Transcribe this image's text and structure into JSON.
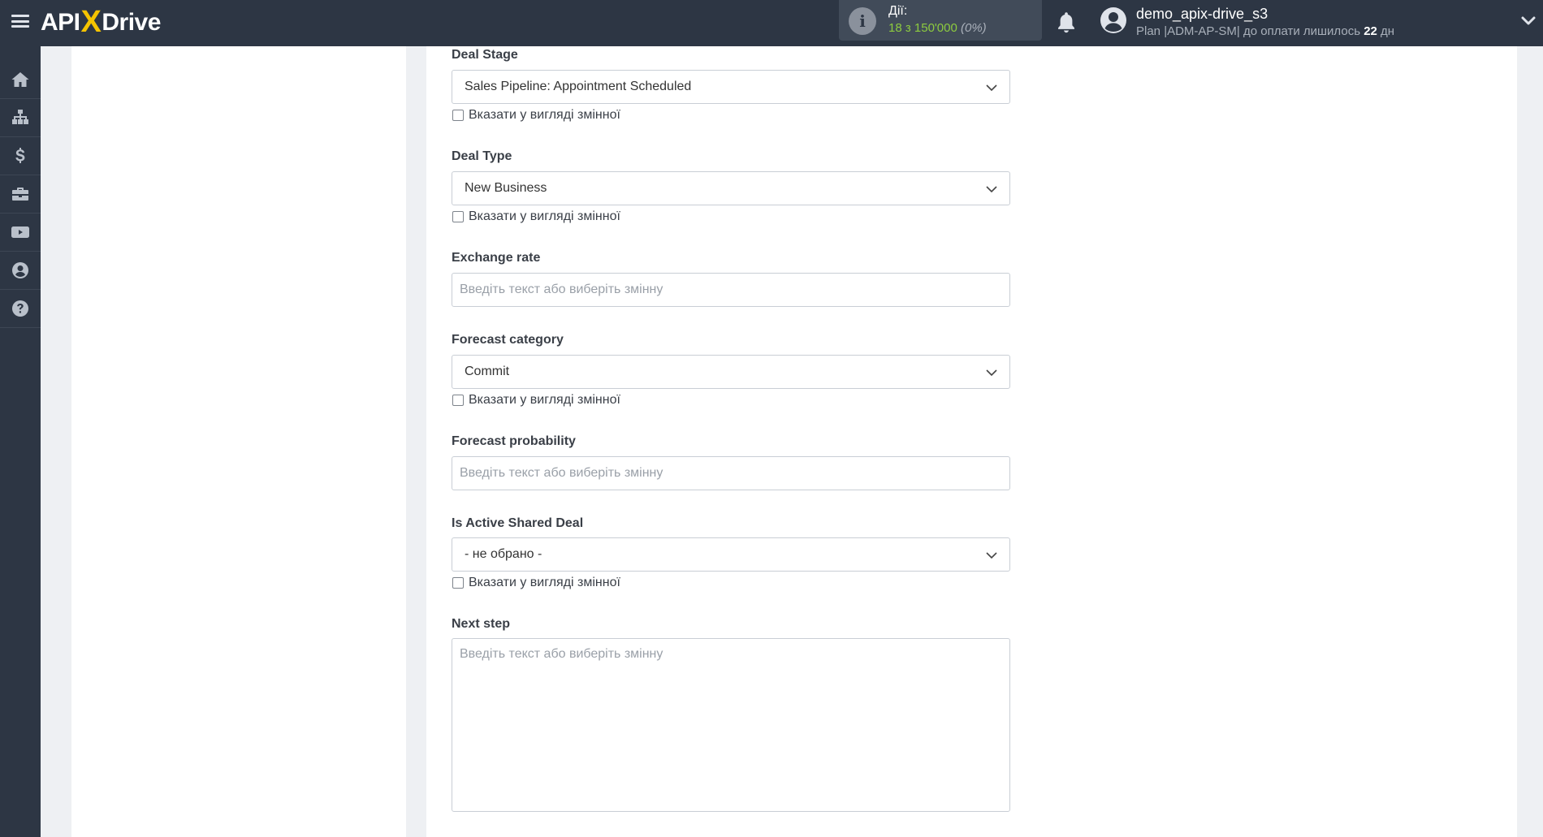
{
  "header": {
    "logo": {
      "part1": "API",
      "part2": "X",
      "part3": "Drive"
    },
    "actions": {
      "label": "Дії:",
      "count": "18 з 150'000",
      "percent": "(0%)"
    },
    "user": {
      "name": "demo_apix-drive_s3",
      "plan_prefix": "Plan |ADM-AP-SM| до оплати лишилось ",
      "plan_days": "22",
      "plan_suffix": " дн"
    }
  },
  "sidebar": {
    "items": [
      {
        "icon": "home-icon"
      },
      {
        "icon": "sitemap-icon"
      },
      {
        "icon": "dollar-icon"
      },
      {
        "icon": "briefcase-icon"
      },
      {
        "icon": "youtube-icon"
      },
      {
        "icon": "user-circle-icon"
      },
      {
        "icon": "question-circle-icon"
      }
    ]
  },
  "form": {
    "variable_checkbox_label": "Вказати у вигляді змінної",
    "input_placeholder": "Введіть текст або виберіть змінну",
    "fields": {
      "deal_stage": {
        "label": "Deal Stage",
        "value": "Sales Pipeline: Appointment Scheduled"
      },
      "deal_type": {
        "label": "Deal Type",
        "value": "New Business"
      },
      "exchange_rate": {
        "label": "Exchange rate",
        "value": ""
      },
      "forecast_category": {
        "label": "Forecast category",
        "value": "Commit"
      },
      "forecast_probability": {
        "label": "Forecast probability",
        "value": ""
      },
      "is_active_shared_deal": {
        "label": "Is Active Shared Deal",
        "value": "- не обрано -"
      },
      "next_step": {
        "label": "Next step",
        "value": ""
      }
    }
  },
  "colors": {
    "topbar": "#2d3644",
    "accent_yellow": "#f5c400",
    "actions_green": "#8dcb3f",
    "page_background": "#eef0f3"
  }
}
